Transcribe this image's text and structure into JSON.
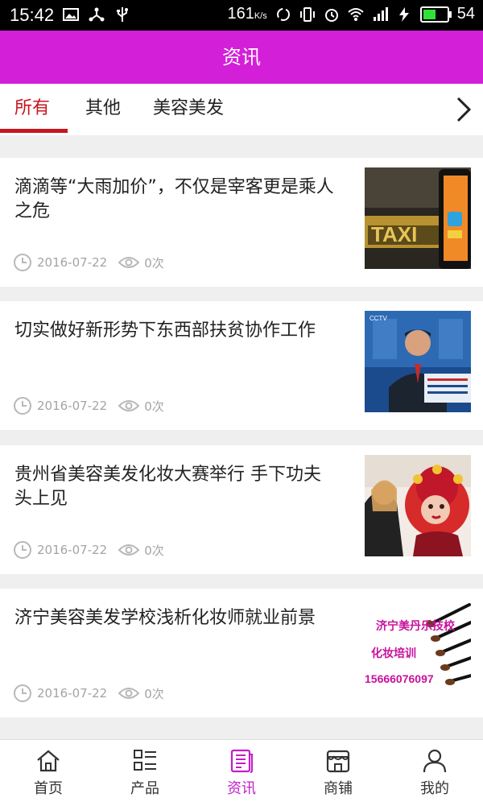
{
  "status_bar": {
    "time": "15:42",
    "network_speed": "161",
    "speed_unit": "K/s",
    "battery_level": "54"
  },
  "header": {
    "title": "资讯"
  },
  "tabs": [
    {
      "label": "所有",
      "active": true
    },
    {
      "label": "其他",
      "active": false
    },
    {
      "label": "美容美发",
      "active": false
    }
  ],
  "news": [
    {
      "title": "滴滴等“大雨加价”，不仅是宰客更是乘人之危",
      "date": "2016-07-22",
      "views": "0次",
      "image": "taxi-photo"
    },
    {
      "title": "切实做好新形势下东西部扶贫协作工作",
      "date": "2016-07-22",
      "views": "0次",
      "image": "news-anchor-photo"
    },
    {
      "title": "贵州省美容美发化妆大赛举行 手下功夫头上见",
      "date": "2016-07-22",
      "views": "0次",
      "image": "makeup-contest-photo"
    },
    {
      "title": "济宁美容美发学校浅析化妆师就业前景",
      "date": "2016-07-22",
      "views": "0次",
      "image": "makeup-training-ad",
      "image_text": [
        "济宁美丹乐技校",
        "化妆培训",
        "15666076097"
      ]
    }
  ],
  "bottom_nav": [
    {
      "label": "首页",
      "icon": "home-icon",
      "active": false
    },
    {
      "label": "产品",
      "icon": "product-list-icon",
      "active": false
    },
    {
      "label": "资讯",
      "icon": "news-icon",
      "active": true
    },
    {
      "label": "商铺",
      "icon": "shop-icon",
      "active": false
    },
    {
      "label": "我的",
      "icon": "profile-icon",
      "active": false
    }
  ],
  "colors": {
    "accent": "#d31fd8",
    "tab_active": "#c6161f",
    "nav_active": "#c21ec8",
    "meta_text": "#a4a4a4"
  }
}
